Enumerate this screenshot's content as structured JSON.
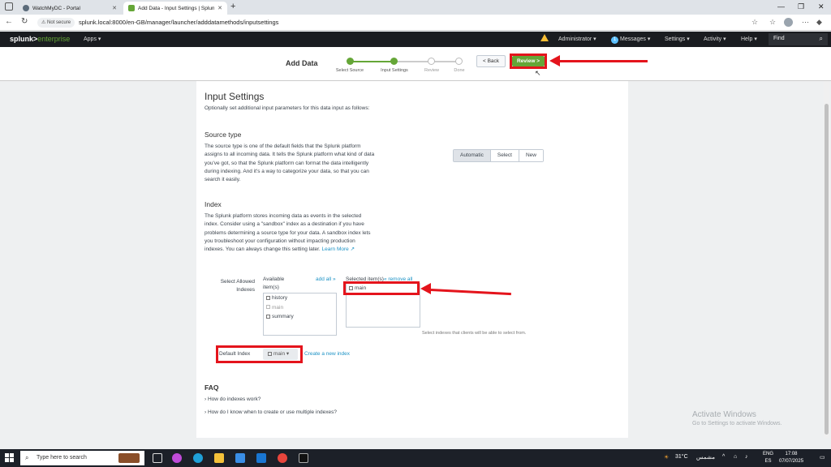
{
  "browser": {
    "tabs": [
      {
        "title": "WatchMyDC - Portal",
        "active": false
      },
      {
        "title": "Add Data - Input Settings | Splunk",
        "active": true
      }
    ],
    "security_label": "Not secure",
    "url": "splunk.local:8000/en-GB/manager/launcher/adddatamethods/inputsettings"
  },
  "splunk_header": {
    "logo_main": "splunk>",
    "logo_sub": "enterprise",
    "apps": "Apps ▾",
    "nav": {
      "administrator": "Administrator ▾",
      "messages_count": "1",
      "messages": "Messages ▾",
      "settings": "Settings ▾",
      "activity": "Activity ▾",
      "help": "Help ▾"
    },
    "find": "Find"
  },
  "wizard": {
    "title": "Add Data",
    "steps": [
      "Select Source",
      "Input Settings",
      "Review",
      "Done"
    ],
    "back_label": "< Back",
    "review_label": "Review >"
  },
  "main": {
    "title": "Input Settings",
    "subtitle": "Optionally set additional input parameters for this data input as follows:",
    "source_type": {
      "heading": "Source type",
      "description": "The source type is one of the default fields that the Splunk platform assigns to all incoming data. It tells the Splunk platform what kind of data you've got, so that the Splunk platform can format the data intelligently during indexing. And it's a way to categorize your data, so that you can search it easily.",
      "options": [
        "Automatic",
        "Select",
        "New"
      ]
    },
    "index": {
      "heading": "Index",
      "description": "The Splunk platform stores incoming data as events in the selected index. Consider using a \"sandbox\" index as a destination if you have problems determining a source type for your data. A sandbox index lets you troubleshoot your configuration without impacting production indexes. You can always change this setting later.",
      "learn_more": "Learn More",
      "allowed_label": "Select Allowed Indexes",
      "available_label": "Available item(s)",
      "add_all": "add all »",
      "available_items": [
        "history",
        "main",
        "summary"
      ],
      "selected_label": "Selected item(s)",
      "remove_all": "« remove all",
      "selected_items": [
        "main"
      ],
      "hint": "Select indexes that clients will be able to select from.",
      "default_label": "Default Index",
      "default_value": "main",
      "create_new": "Create a new index"
    },
    "faq": {
      "heading": "FAQ",
      "items": [
        "How do indexes work?",
        "How do I know when to create or use multiple indexes?"
      ]
    }
  },
  "watermark": {
    "line1": "Activate Windows",
    "line2": "Go to Settings to activate Windows."
  },
  "taskbar": {
    "search_placeholder": "Type here to search",
    "weather": "31°C",
    "weather_desc": "مشمس",
    "lang": "ENG",
    "lang2": "ES",
    "time": "17:08",
    "date": "07/07/2025"
  },
  "colors": {
    "accent_green": "#65a637",
    "highlight_red": "#e4141c",
    "link_blue": "#1e93c6",
    "splunk_bar": "#1a1c20"
  }
}
